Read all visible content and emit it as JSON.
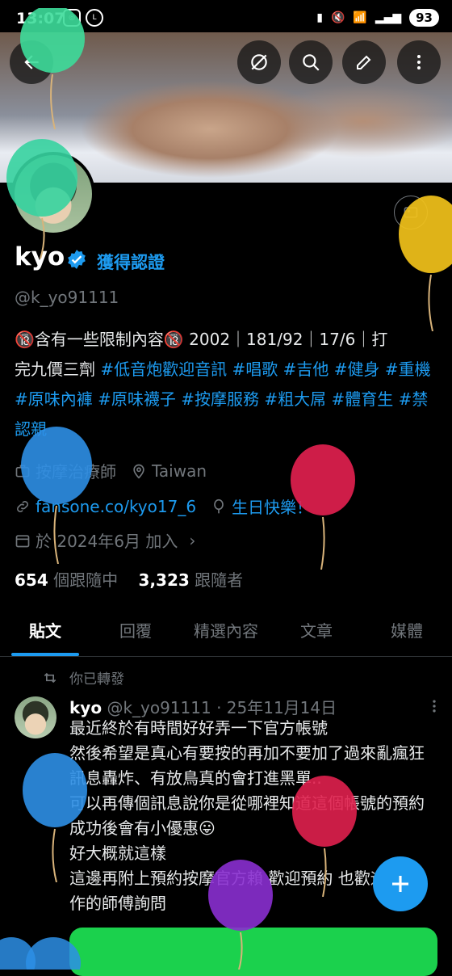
{
  "status_bar": {
    "time": "13:07",
    "battery": "93"
  },
  "profile": {
    "name": "kyo",
    "verified_label": "獲得認證",
    "handle": "@k_yo91111",
    "bio_lines": [
      "🔞含有一些限制內容🔞 2002｜181/92｜17/6｜打",
      "完九價三劑"
    ],
    "bio_tags": [
      "#低音炮歡迎音訊",
      "#唱歌",
      "#吉他",
      "#健身",
      "#重機",
      "#原味內褲",
      "#原味襪子",
      "#按摩服務",
      "#粗大屌",
      "#體育生",
      "#禁認親"
    ],
    "profession": "按摩治療師",
    "location": "Taiwan",
    "link": "fansone.co/kyo17_6",
    "birthday": "生日快樂！",
    "joined": "於 2024年6月 加入",
    "following_count": "654",
    "following_label": "個跟隨中",
    "followers_count": "3,323",
    "followers_label": "跟隨者"
  },
  "tabs": [
    "貼文",
    "回覆",
    "精選內容",
    "文章",
    "媒體"
  ],
  "post": {
    "repost_label": "你已轉發",
    "author": "kyo",
    "handle_date": "@k_yo91111 · 25年11月14日",
    "body": "最近終於有時間好好弄一下官方帳號\n然後希望是真心有要按的再加不要加了過來亂瘋狂訊息轟炸、有放鳥真的會打進黑單..\n可以再傳個訊息說你是從哪裡知道這個帳號的預約成功後會有小優惠😛\n好大概就這樣\n這邊再附上預約按摩官方賴 歡迎預約 也歡迎想合作的師傅詢問"
  },
  "colors": {
    "accent": "#1d9bf0",
    "muted": "#71767b",
    "card": "#1bd14d"
  }
}
